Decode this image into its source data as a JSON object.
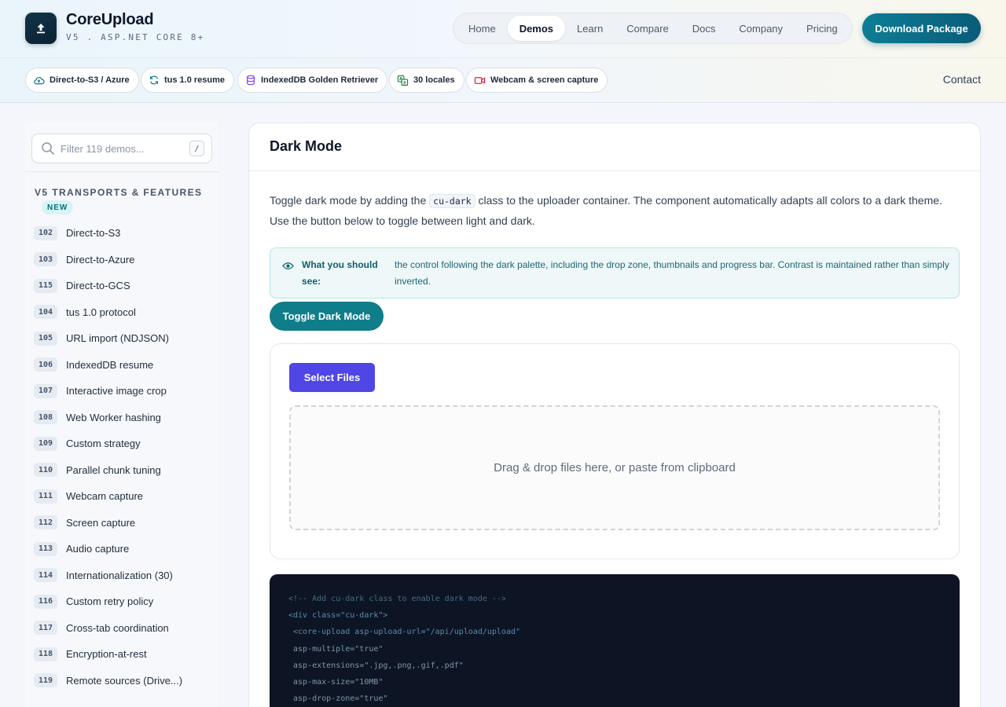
{
  "brand": {
    "name": "CoreUpload",
    "subtitle": "V5 . ASP.NET CORE 8+"
  },
  "nav": {
    "items": [
      {
        "label": "Home"
      },
      {
        "label": "Demos"
      },
      {
        "label": "Learn"
      },
      {
        "label": "Compare"
      },
      {
        "label": "Docs"
      },
      {
        "label": "Company"
      },
      {
        "label": "Pricing"
      }
    ],
    "active": "Demos",
    "download_label": "Download Package"
  },
  "features": [
    {
      "label": "Direct-to-S3 / Azure",
      "icon": "cloud-upload-icon"
    },
    {
      "label": "tus 1.0 resume",
      "icon": "refresh-icon"
    },
    {
      "label": "IndexedDB Golden Retriever",
      "icon": "database-icon"
    },
    {
      "label": "30 locales",
      "icon": "translate-icon"
    },
    {
      "label": "Webcam & screen capture",
      "icon": "video-icon"
    }
  ],
  "contact_label": "Contact",
  "sidebar": {
    "search_placeholder": "Filter 119 demos...",
    "search_shortcut": "/",
    "section_title": "V5 TRANSPORTS & FEATURES",
    "section_badge": "NEW",
    "items": [
      {
        "num": "102",
        "label": "Direct-to-S3"
      },
      {
        "num": "103",
        "label": "Direct-to-Azure"
      },
      {
        "num": "115",
        "label": "Direct-to-GCS"
      },
      {
        "num": "104",
        "label": "tus 1.0 protocol"
      },
      {
        "num": "105",
        "label": "URL import (NDJSON)"
      },
      {
        "num": "106",
        "label": "IndexedDB resume"
      },
      {
        "num": "107",
        "label": "Interactive image crop"
      },
      {
        "num": "108",
        "label": "Web Worker hashing"
      },
      {
        "num": "109",
        "label": "Custom strategy"
      },
      {
        "num": "110",
        "label": "Parallel chunk tuning"
      },
      {
        "num": "111",
        "label": "Webcam capture"
      },
      {
        "num": "112",
        "label": "Screen capture"
      },
      {
        "num": "113",
        "label": "Audio capture"
      },
      {
        "num": "114",
        "label": "Internationalization (30)"
      },
      {
        "num": "116",
        "label": "Custom retry policy"
      },
      {
        "num": "117",
        "label": "Cross-tab coordination"
      },
      {
        "num": "118",
        "label": "Encryption-at-rest"
      },
      {
        "num": "119",
        "label": "Remote sources (Drive...)"
      }
    ]
  },
  "main": {
    "title": "Dark Mode",
    "desc_before": "Toggle dark mode by adding the ",
    "desc_code": "cu-dark",
    "desc_after": " class to the uploader container. The component automatically adapts all colors to a dark theme. Use the button below to toggle between light and dark.",
    "callout_label": "What you should see:",
    "callout_text": "the control following the dark palette, including the drop zone, thumbnails and progress bar. Contrast is maintained rather than simply inverted.",
    "toggle_label": "Toggle Dark Mode",
    "select_label": "Select Files",
    "dropzone_text": "Drag & drop files here, or paste from clipboard",
    "code_lines": [
      "<!-- Add cu-dark class to enable dark mode -->",
      "<div class=\"cu-dark\">",
      " <core-upload asp-upload-url=\"/api/upload/upload\"",
      " asp-multiple=\"true\"",
      " asp-extensions=\".jpg,.png,.gif,.pdf\"",
      " asp-max-size=\"10MB\"",
      " asp-drop-zone=\"true\""
    ]
  }
}
